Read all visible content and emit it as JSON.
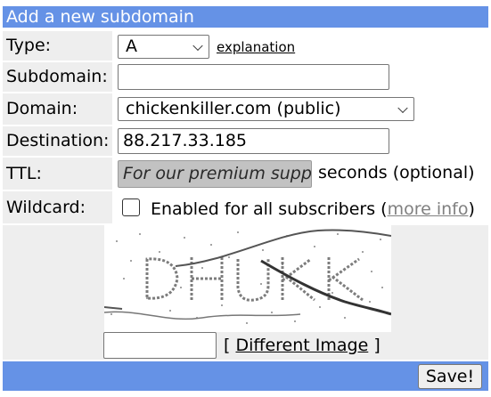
{
  "form": {
    "title": "Add a new subdomain",
    "type": {
      "label": "Type:",
      "selected": "A",
      "help_link": "explanation"
    },
    "subdomain": {
      "label": "Subdomain:",
      "value": ""
    },
    "domain": {
      "label": "Domain:",
      "selected": "chickenkiller.com (public)"
    },
    "destination": {
      "label": "Destination:",
      "value": "88.217.33.185"
    },
    "ttl": {
      "label": "TTL:",
      "placeholder": "For our premium suppo",
      "suffix": "seconds (optional)"
    },
    "wildcard": {
      "label": "Wildcard:",
      "checked": false,
      "text": "Enabled for all subscribers (",
      "more_info": "more info",
      "close_paren": ")"
    },
    "captcha": {
      "text_shown": "DHUKK",
      "input_value": "",
      "refresh_open": "[",
      "refresh_label": "Different Image",
      "refresh_close": "]"
    },
    "save_label": "Save!"
  },
  "colors": {
    "header_bg": "#6592e6",
    "label_bg": "#eeeeee",
    "disabled_input_bg": "#c2c2c2",
    "muted_link": "#808080"
  }
}
